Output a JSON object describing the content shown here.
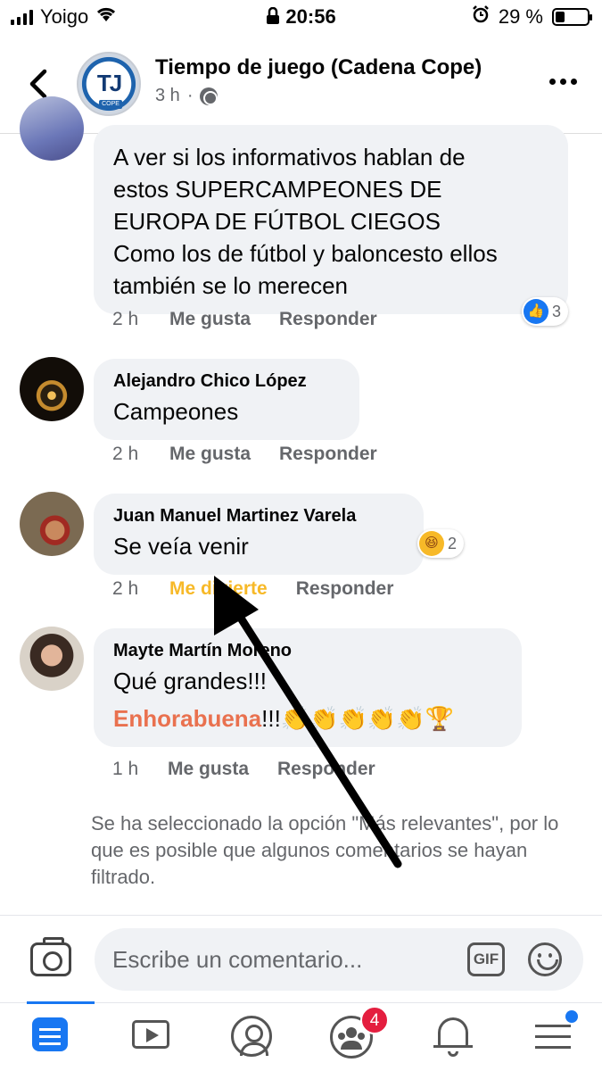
{
  "status_bar": {
    "carrier": "Yoigo",
    "time": "20:56",
    "battery_text": "29 %",
    "battery_level": 0.29
  },
  "header": {
    "page_name": "Tiempo de juego (Cadena Cope)",
    "avatar_initials": "TJ",
    "avatar_sub": "COPE",
    "age": "3 h"
  },
  "comments": [
    {
      "text_lines": [
        "A ver si los informativos hablan de",
        "estos SUPERCAMPEONES DE",
        "EUROPA DE FÚTBOL CIEGOS",
        "Como los de fútbol y baloncesto ellos",
        "también se lo merecen"
      ],
      "time": "2 h",
      "like_label": "Me gusta",
      "reply_label": "Responder",
      "reaction_count": "3"
    },
    {
      "author": "Alejandro Chico López",
      "text": "Campeones",
      "time": "2 h",
      "like_label": "Me gusta",
      "reply_label": "Responder"
    },
    {
      "author": "Juan Manuel Martinez Varela",
      "text": "Se veía venir",
      "time": "2 h",
      "like_label": "Me divierte",
      "reply_label": "Responder",
      "reaction_count": "2"
    },
    {
      "author": "Mayte Martín Moreno",
      "text": "Qué grandes!!!",
      "highlight": "Enhorabuena",
      "suffix": "!!!👏👏👏👏👏🏆",
      "time": "1 h",
      "like_label": "Me gusta",
      "reply_label": "Responder"
    }
  ],
  "filter_note": "Se ha seleccionado la opción \"Más relevantes\", por lo que es posible que algunos comentarios se hayan filtrado.",
  "composer": {
    "placeholder": "Escribe un comentario...",
    "gif_label": "GIF"
  },
  "bottom_nav": {
    "groups_badge": "4"
  },
  "colors": {
    "facebook_blue": "#1877f2",
    "haha_orange": "#f7b928",
    "highlight_orange": "#e9714f",
    "bubble_bg": "#f0f2f5"
  }
}
